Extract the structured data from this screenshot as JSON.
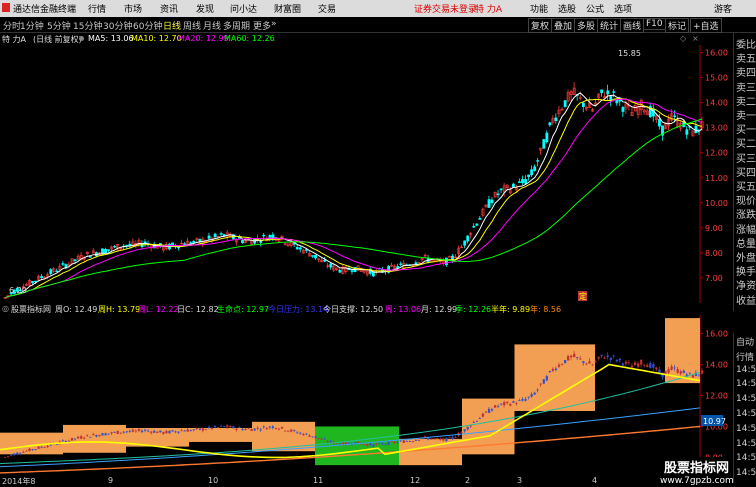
{
  "titlebar": {
    "app_title": "通达信金融终端",
    "menus": [
      "行情",
      "市场",
      "资讯",
      "发现",
      "问小达",
      "财富圈",
      "交易"
    ],
    "login_notice": "证券交易未登录",
    "stock_name": "特 力A",
    "right_menus": [
      "功能",
      "选股",
      "公式",
      "选项",
      "游客"
    ]
  },
  "toolbar": {
    "periods": [
      "分时",
      "1分钟",
      "5分钟",
      "15分钟",
      "30分钟",
      "60分钟",
      "日线",
      "周线",
      "月线",
      "多周期",
      "更多"
    ],
    "selected_period": "日线",
    "right_buttons": [
      "复权",
      "叠加",
      "多股",
      "统计",
      "画线",
      "F10",
      "标记",
      "+自选"
    ]
  },
  "infobar": {
    "stock_label": "特 力A",
    "mode": "(日线 前复权)",
    "ma5_label": "MA5: 13.06",
    "ma10_label": "MA10: 12.70",
    "ma20_label": "MA20: 12.99",
    "ma60_label": "MA60: 12.26"
  },
  "chart_annotations": {
    "high_label": "15.85",
    "low_label": "6.20",
    "event_label": "定"
  },
  "indicator_bar": {
    "name": "股票指标网",
    "week_o": "周O: 12.49",
    "week_h": "周H: 13.79",
    "week_l": "周L: 12.22",
    "day_c": "日C: 12.82",
    "lifeline": "生命点: 12.97",
    "today_pressure": "今日压力: 13.14",
    "today_support": "今日支撑: 12.50",
    "week": "周: 13.06",
    "month": "月: 12.99",
    "season": "季: 12.26",
    "half_year": "半年: 9.89",
    "year": "年: 8.56"
  },
  "indicator_annotations": {
    "current_value": "10.97"
  },
  "right_panel": {
    "items": [
      "委比",
      "卖五",
      "卖四",
      "卖三",
      "卖二",
      "卖一",
      "买一",
      "买二",
      "买三",
      "买四",
      "买五",
      "现价",
      "涨跌",
      "涨幅",
      "总量",
      "外盘",
      "换手",
      "净资",
      "收益"
    ],
    "lower_items": [
      "自动",
      "行情",
      "14:55",
      "14:55",
      "14:55",
      "14:55",
      "14:55",
      "14:55",
      "14:55",
      "14:55"
    ]
  },
  "date_axis": {
    "labels": [
      "2014年8",
      "9",
      "10",
      "11",
      "12",
      "2",
      "3",
      "4"
    ]
  },
  "watermark": {
    "line1": "股票指标网",
    "line2": "www.7gpzb.com"
  },
  "colors": {
    "up": "#ff3b3b",
    "down": "#00ffff",
    "ma5": "#ffffff",
    "ma10": "#ffff00",
    "ma20": "#ff00ff",
    "ma60": "#00ff00",
    "box_orange": "#ffa858",
    "box_green": "#22c022"
  },
  "chart_data": [
    {
      "type": "candlestick",
      "title": "特 力A (日线 前复权)",
      "ylim": [
        6.0,
        16.3
      ],
      "yticks": [
        7.0,
        8.0,
        9.0,
        10.0,
        11.0,
        12.0,
        13.0,
        14.0,
        15.0,
        16.0
      ],
      "x_categories": [
        "2014年8",
        "9",
        "10",
        "11",
        "12",
        "2",
        "3",
        "4"
      ],
      "series_close_approx": [
        6.2,
        6.5,
        6.7,
        6.9,
        7.1,
        7.3,
        7.5,
        7.7,
        7.9,
        8.0,
        8.1,
        8.2,
        8.3,
        8.3,
        8.4,
        8.3,
        8.2,
        8.3,
        8.4,
        8.4,
        8.5,
        8.6,
        8.7,
        8.6,
        8.5,
        8.5,
        8.6,
        8.7,
        8.5,
        8.3,
        8.1,
        7.9,
        7.6,
        7.4,
        7.3,
        7.4,
        7.3,
        7.2,
        7.3,
        7.4,
        7.5,
        7.6,
        7.8,
        7.7,
        7.6,
        7.8,
        8.3,
        9.0,
        9.6,
        10.2,
        10.5,
        10.6,
        10.8,
        11.2,
        12.2,
        13.3,
        13.9,
        14.4,
        14.0,
        13.7,
        14.4,
        14.3,
        13.9,
        13.6,
        13.9,
        13.6,
        12.9,
        13.4,
        13.1,
        12.8,
        13.1
      ],
      "max": 15.85,
      "min": 6.2
    },
    {
      "type": "indicator",
      "ylim": [
        6.8,
        17.2
      ],
      "yticks": [
        8.0,
        10.0,
        12.0,
        14.0,
        16.0
      ],
      "current": 10.97
    }
  ]
}
